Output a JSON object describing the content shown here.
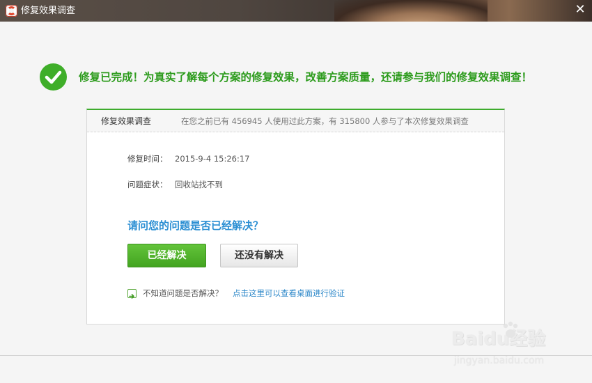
{
  "window": {
    "title": "修复效果调查",
    "close_icon": "close-icon"
  },
  "banner": {
    "icon": "checkmark-circle-icon",
    "text": "修复已完成！为真实了解每个方案的修复效果，改善方案质量，还请参与我们的修复效果调查！"
  },
  "card": {
    "title": "修复效果调查",
    "stats": "在您之前已有 456945 人使用过此方案，有 315800 人参与了本次修复效果调查",
    "rows": [
      {
        "label": "修复时间：",
        "value": "2015-9-4 15:26:17"
      },
      {
        "label": "问题症状：",
        "value": "回收站找不到"
      }
    ],
    "question": "请问您的问题是否已经解决？",
    "buttons": {
      "solved": "已经解决",
      "unsolved": "还没有解决"
    },
    "hint": {
      "icon": "arrow-right-icon",
      "text": "不知道问题是否解决？",
      "link": "点击这里可以查看桌面进行验证"
    }
  },
  "watermark": {
    "brand": "Baidu经验",
    "url": "jingyan.baidu.com"
  },
  "colors": {
    "accent_green": "#3fae29",
    "banner_text": "#2c9b1c",
    "question_blue": "#2c8fd3",
    "link_blue": "#2a86c8"
  }
}
